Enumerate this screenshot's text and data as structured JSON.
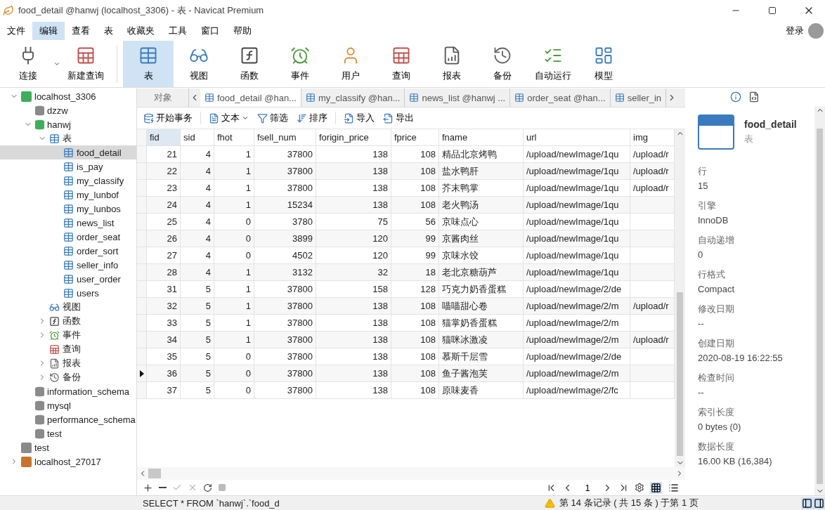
{
  "window": {
    "title": "food_detail @hanwj (localhost_3306) - 表 - Navicat Premium"
  },
  "menu": [
    {
      "label": "文件",
      "selected": false
    },
    {
      "label": "编辑",
      "selected": true
    },
    {
      "label": "查看",
      "selected": false
    },
    {
      "label": "表",
      "selected": false
    },
    {
      "label": "收藏夹",
      "selected": false
    },
    {
      "label": "工具",
      "selected": false
    },
    {
      "label": "窗口",
      "selected": false
    },
    {
      "label": "帮助",
      "selected": false
    }
  ],
  "login": "登录",
  "toolbar": [
    {
      "label": "连接",
      "kind": "connect",
      "selected": false,
      "dropdown": true
    },
    {
      "label": "新建查询",
      "kind": "new-query",
      "selected": false
    },
    {
      "label": "表",
      "kind": "table",
      "selected": true
    },
    {
      "label": "视图",
      "kind": "view",
      "selected": false
    },
    {
      "label": "函数",
      "kind": "function",
      "selected": false
    },
    {
      "label": "事件",
      "kind": "event",
      "selected": false
    },
    {
      "label": "用户",
      "kind": "user",
      "selected": false
    },
    {
      "label": "查询",
      "kind": "query",
      "selected": false
    },
    {
      "label": "报表",
      "kind": "report",
      "selected": false
    },
    {
      "label": "备份",
      "kind": "backup",
      "selected": false
    },
    {
      "label": "自动运行",
      "kind": "automation",
      "selected": false
    },
    {
      "label": "模型",
      "kind": "model",
      "selected": false
    }
  ],
  "tree": [
    {
      "label": "localhost_3306",
      "kind": "connection",
      "color": "#3fae5a",
      "expanded": true,
      "selected": false,
      "children": [
        {
          "label": "dzzw",
          "kind": "database",
          "color": "#8a8a8a",
          "selected": false
        },
        {
          "label": "hanwj",
          "kind": "database",
          "color": "#3fae5a",
          "expanded": true,
          "selected": false,
          "children": [
            {
              "label": "表",
              "kind": "tables",
              "expanded": true,
              "selected": false,
              "children": [
                {
                  "label": "food_detail",
                  "kind": "table",
                  "selected": true
                },
                {
                  "label": "is_pay",
                  "kind": "table",
                  "selected": false
                },
                {
                  "label": "my_classify",
                  "kind": "table",
                  "selected": false
                },
                {
                  "label": "my_lunbof",
                  "kind": "table",
                  "selected": false
                },
                {
                  "label": "my_lunbos",
                  "kind": "table",
                  "selected": false
                },
                {
                  "label": "news_list",
                  "kind": "table",
                  "selected": false
                },
                {
                  "label": "order_seat",
                  "kind": "table",
                  "selected": false
                },
                {
                  "label": "order_sort",
                  "kind": "table",
                  "selected": false
                },
                {
                  "label": "seller_info",
                  "kind": "table",
                  "selected": false
                },
                {
                  "label": "user_order",
                  "kind": "table",
                  "selected": false
                },
                {
                  "label": "users",
                  "kind": "table",
                  "selected": false
                }
              ]
            },
            {
              "label": "视图",
              "kind": "view",
              "selected": false
            },
            {
              "label": "函数",
              "kind": "function",
              "expanded": false,
              "selected": false
            },
            {
              "label": "事件",
              "kind": "event",
              "expanded": false,
              "selected": false
            },
            {
              "label": "查询",
              "kind": "query",
              "selected": false
            },
            {
              "label": "报表",
              "kind": "report",
              "expanded": false,
              "selected": false
            },
            {
              "label": "备份",
              "kind": "backup",
              "expanded": false,
              "selected": false
            }
          ]
        },
        {
          "label": "information_schema",
          "kind": "database",
          "color": "#8a8a8a",
          "selected": false
        },
        {
          "label": "mysql",
          "kind": "database",
          "color": "#8a8a8a",
          "selected": false
        },
        {
          "label": "performance_schema",
          "kind": "database",
          "color": "#8a8a8a",
          "selected": false
        },
        {
          "label": "test",
          "kind": "database",
          "color": "#8a8a8a",
          "selected": false
        }
      ]
    },
    {
      "label": "test",
      "kind": "connection",
      "color": "#8a8a8a",
      "selected": false
    },
    {
      "label": "localhost_27017",
      "kind": "connection",
      "color": "#c8742e",
      "expanded": false,
      "selected": false
    }
  ],
  "tabs": [
    {
      "label": "对象",
      "kind": "objects",
      "selected": false
    },
    {
      "label": "food_detail @han...",
      "kind": "table",
      "selected": true
    },
    {
      "label": "my_classify @han...",
      "kind": "table",
      "selected": false
    },
    {
      "label": "news_list @hanwj ...",
      "kind": "table",
      "selected": false
    },
    {
      "label": "order_seat @han...",
      "kind": "table",
      "selected": false
    },
    {
      "label": "seller_in",
      "kind": "table",
      "selected": false
    }
  ],
  "actions": [
    {
      "label": "开始事务",
      "kind": "transaction"
    },
    {
      "label": "文本",
      "kind": "text",
      "dropdown": true
    },
    {
      "label": "筛选",
      "kind": "filter"
    },
    {
      "label": "排序",
      "kind": "sort"
    },
    {
      "label": "导入",
      "kind": "import"
    },
    {
      "label": "导出",
      "kind": "export"
    }
  ],
  "table": {
    "columns": [
      {
        "label": "fid",
        "kind": "number"
      },
      {
        "label": "sid",
        "kind": "number"
      },
      {
        "label": "fhot",
        "kind": "number"
      },
      {
        "label": "fsell_num",
        "kind": "number"
      },
      {
        "label": "forigin_price",
        "kind": "number"
      },
      {
        "label": "fprice",
        "kind": "number"
      },
      {
        "label": "fname",
        "kind": "text"
      },
      {
        "label": "url",
        "kind": "text"
      },
      {
        "label": "img",
        "kind": "text"
      }
    ],
    "rows": [
      {
        "current": false,
        "cells": [
          "21",
          "4",
          "1",
          "37800",
          "138",
          "108",
          "精品北京烤鸭",
          "/upload/newImage/1qu",
          "/upload/r"
        ]
      },
      {
        "current": false,
        "cells": [
          "22",
          "4",
          "1",
          "37800",
          "138",
          "108",
          "盐水鸭肝",
          "/upload/newImage/1qu",
          "/upload/r"
        ]
      },
      {
        "current": false,
        "cells": [
          "23",
          "4",
          "1",
          "37800",
          "138",
          "108",
          "芥末鸭掌",
          "/upload/newImage/1qu",
          "/upload/r"
        ]
      },
      {
        "current": false,
        "cells": [
          "24",
          "4",
          "1",
          "15234",
          "138",
          "108",
          "老火鸭汤",
          "/upload/newImage/1qu"
        ]
      },
      {
        "current": false,
        "cells": [
          "25",
          "4",
          "0",
          "3780",
          "75",
          "56",
          "京味点心",
          "/upload/newImage/1qu"
        ]
      },
      {
        "current": false,
        "cells": [
          "26",
          "4",
          "0",
          "3899",
          "120",
          "99",
          "京酱肉丝",
          "/upload/newImage/1qu"
        ]
      },
      {
        "current": false,
        "cells": [
          "27",
          "4",
          "0",
          "4502",
          "120",
          "99",
          "京味水饺",
          "/upload/newImage/1qu"
        ]
      },
      {
        "current": false,
        "cells": [
          "28",
          "4",
          "1",
          "3132",
          "32",
          "18",
          "老北京糖葫芦",
          "/upload/newImage/1qu"
        ]
      },
      {
        "current": false,
        "cells": [
          "31",
          "5",
          "1",
          "37800",
          "158",
          "128",
          "巧克力奶香蛋糕",
          "/upload/newImage/2/de"
        ]
      },
      {
        "current": false,
        "cells": [
          "32",
          "5",
          "1",
          "37800",
          "138",
          "108",
          "喵喵甜心卷",
          "/upload/newImage/2/m",
          "/upload/r"
        ]
      },
      {
        "current": false,
        "cells": [
          "33",
          "5",
          "1",
          "37800",
          "138",
          "108",
          "猫掌奶香蛋糕",
          "/upload/newImage/2/m"
        ]
      },
      {
        "current": false,
        "cells": [
          "34",
          "5",
          "1",
          "37800",
          "138",
          "108",
          "猫咪冰激凌",
          "/upload/newImage/2/m",
          "/upload/r"
        ]
      },
      {
        "current": false,
        "cells": [
          "35",
          "5",
          "0",
          "37800",
          "138",
          "108",
          "慕斯千层雪",
          "/upload/newImage/2/de"
        ]
      },
      {
        "current": true,
        "cells": [
          "36",
          "5",
          "0",
          "37800",
          "138",
          "108",
          "鱼子酱泡芙",
          "/upload/newImage/2/m"
        ]
      },
      {
        "current": false,
        "cells": [
          "37",
          "5",
          "0",
          "37800",
          "138",
          "108",
          "原味麦香",
          "/upload/newImage/2/fc"
        ]
      }
    ]
  },
  "pager": {
    "page": "1"
  },
  "info": {
    "name": "food_detail",
    "type": "表",
    "properties": [
      {
        "label": "行",
        "value": "15"
      },
      {
        "label": "引擎",
        "value": "InnoDB"
      },
      {
        "label": "自动递增",
        "value": "0"
      },
      {
        "label": "行格式",
        "value": "Compact"
      },
      {
        "label": "修改日期",
        "value": "--"
      },
      {
        "label": "创建日期",
        "value": "2020-08-19 16:22:55"
      },
      {
        "label": "检查时间",
        "value": "--"
      },
      {
        "label": "索引长度",
        "value": "0 bytes (0)"
      },
      {
        "label": "数据长度",
        "value": "16.00 KB (16,384)"
      }
    ]
  },
  "status_bar": {
    "sql": "SELECT * FROM `hanwj`.`food_d",
    "record": "第 14 条记录 ( 共 15 条 ) 于第 1 页"
  }
}
